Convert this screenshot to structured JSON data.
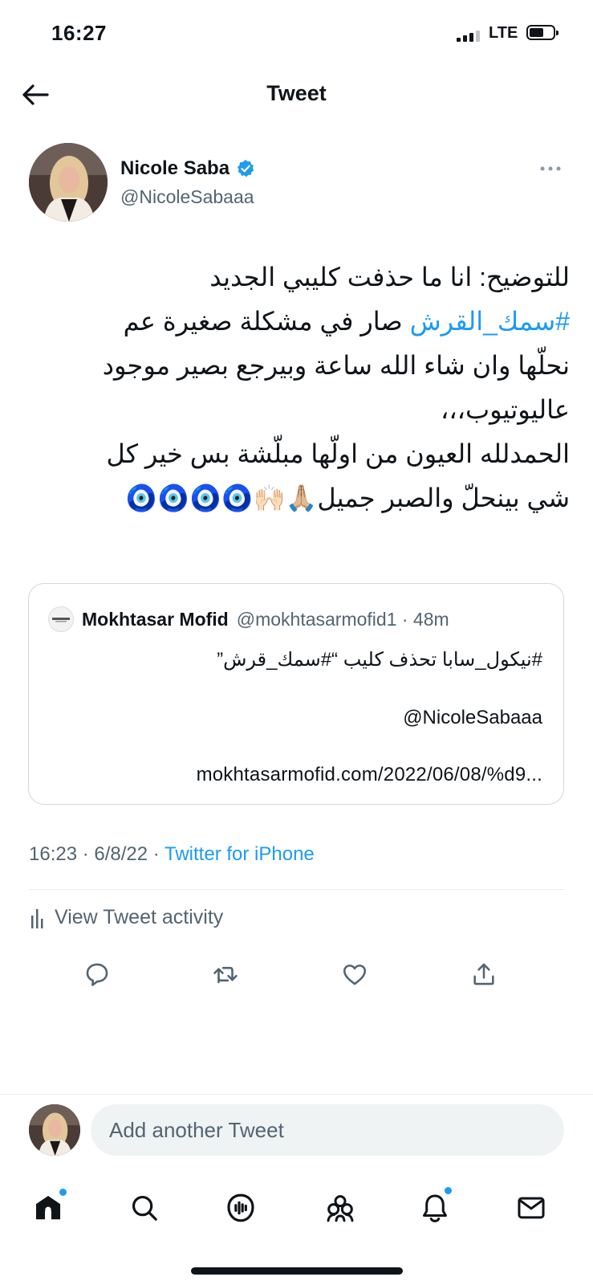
{
  "status_bar": {
    "time": "16:27",
    "network": "LTE"
  },
  "header": {
    "title": "Tweet"
  },
  "tweet": {
    "author_name": "Nicole Saba",
    "author_handle": "@NicoleSabaaa",
    "text_line1": "للتوضيح: انا ما حذفت كليبي الجديد",
    "hashtag": "#سمك_القرش",
    "text_line2_rest": " صار في مشكلة صغيرة عم",
    "text_line3": "نحلّها وان شاء الله ساعة وبيرجع بصير موجود",
    "text_line4": "عاليوتيوب،،،",
    "text_line5": "الحمدلله العيون من اولّها مبلّشة بس خير كل",
    "text_line6": "شي بينحلّ والصبر جميل🙏🏼🙌🏻🧿🧿🧿🧿",
    "timestamp": "16:23 · 6/8/22 · ",
    "source": "Twitter for iPhone"
  },
  "quote": {
    "name": "Mokhtasar Mofid",
    "handle_time": "@mokhtasarmofid1 · 48m",
    "line1": "#نيكول_سابا تحذف كليب “#سمك_قرش”",
    "line2": "@NicoleSabaaa",
    "line3": "mokhtasarmofid.com/2022/06/08/%d9..."
  },
  "activity": {
    "label": "View Tweet activity"
  },
  "reply": {
    "placeholder": "Add another Tweet"
  },
  "colors": {
    "accent": "#1d9bf0",
    "text": "#0f1419",
    "secondary": "#536471",
    "border": "#cfd9de",
    "like": "#536471"
  },
  "actions": [
    "reply-icon",
    "retweet-icon",
    "like-icon",
    "share-icon"
  ],
  "nav": [
    "home-icon",
    "search-icon",
    "spaces-icon",
    "communities-icon",
    "notifications-icon",
    "messages-icon"
  ]
}
